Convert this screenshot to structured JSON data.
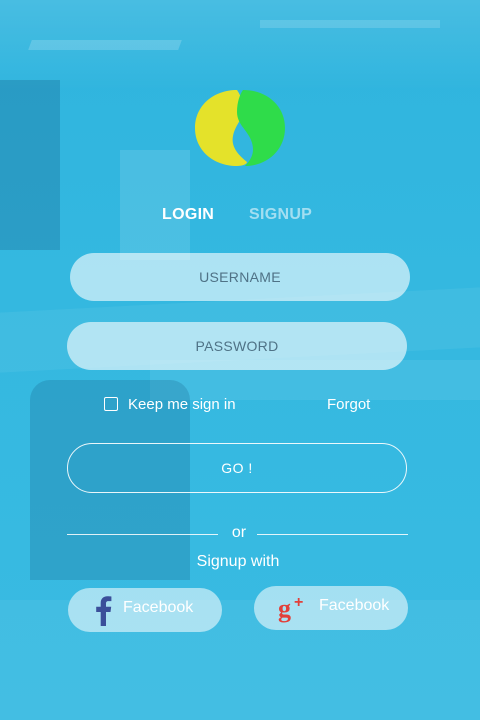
{
  "colors": {
    "background": "#34b8e0",
    "logo_yellow": "#e4e22a",
    "logo_green": "#2fdc4a",
    "facebook_blue": "#3b4f9a",
    "google_red": "#e2403a"
  },
  "tabs": {
    "login": "LOGIN",
    "signup": "SIGNUP",
    "active": "LOGIN"
  },
  "form": {
    "username_placeholder": "USERNAME",
    "password_placeholder": "PASSWORD",
    "remember_label": "Keep me sign in",
    "remember_checked": false,
    "forgot_label": "Forgot",
    "submit_label": "GO !"
  },
  "social": {
    "or_text": "or",
    "signup_with": "Signup with",
    "buttons": [
      {
        "label": "Facebook",
        "icon": "facebook-icon"
      },
      {
        "label": "Facebook",
        "icon": "google-plus-icon"
      }
    ]
  }
}
